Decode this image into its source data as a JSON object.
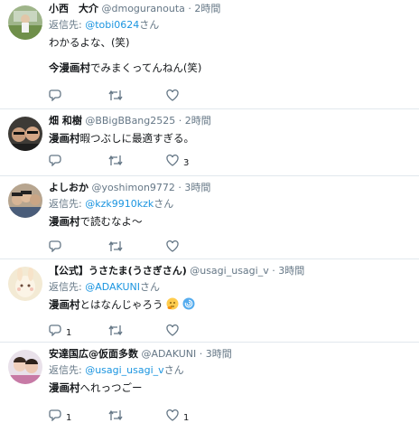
{
  "tweets": [
    {
      "name": "小西　大介",
      "handle": "@dmoguranouta",
      "sep": "·",
      "time": "2時間",
      "reply_label": "返信先: ",
      "reply_to": "@tobi0624",
      "reply_suffix": "さん",
      "line1": "わかるよな、(笑)",
      "line2_bold": "今漫画村",
      "line2_rest": "でみまくってんねん(笑)",
      "likes": ""
    },
    {
      "name": "畑 和樹",
      "handle": "@BBigBBang2525",
      "sep": "·",
      "time": "2時間",
      "line1_bold": "漫画村",
      "line1_rest": "暇つぶしに最適すぎる。",
      "likes": "3"
    },
    {
      "name": "よしおか",
      "handle": "@yoshimon9772",
      "sep": "·",
      "time": "3時間",
      "reply_label": "返信先: ",
      "reply_to": "@kzk9910kzk",
      "reply_suffix": "さん",
      "line1_bold": "漫画村",
      "line1_rest": "で読むなよ〜",
      "likes": ""
    },
    {
      "name": "【公式】うさたま(うさぎさん)",
      "handle": "@usagi_usagi_v",
      "sep": "·",
      "time": "3時間",
      "reply_label": "返信先: ",
      "reply_to": "@ADAKUNI",
      "reply_suffix": "さん",
      "line1_bold": "漫画村",
      "line1_rest": "とはなんじゃろう",
      "replies": "1",
      "likes": ""
    },
    {
      "name": "安達国広@仮面多数",
      "handle": "@ADAKUNI",
      "sep": "·",
      "time": "3時間",
      "reply_label": "返信先: ",
      "reply_to": "@usagi_usagi_v",
      "reply_suffix": "さん",
      "line1_bold": "漫画村",
      "line1_rest": "へれっつごー",
      "replies": "1",
      "likes": "1"
    }
  ],
  "icons": {
    "reply": "reply-icon",
    "retweet": "retweet-icon",
    "like": "heart-icon",
    "thinking": "thinking-face-emoji",
    "cyclone": "cyclone-emoji"
  },
  "colors": {
    "link": "#1b95e0",
    "muted": "#657786",
    "divider": "#e1e8ed"
  }
}
